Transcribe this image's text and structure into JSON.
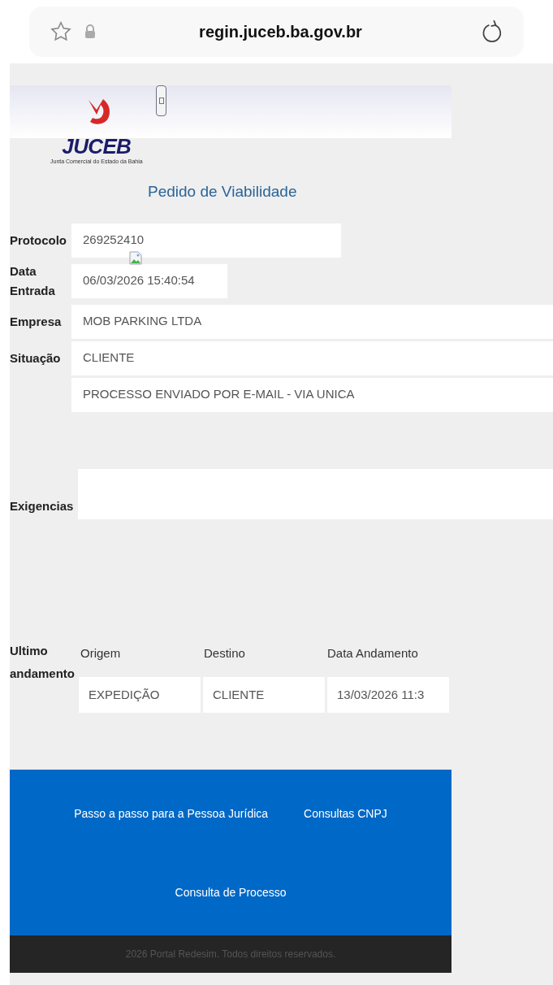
{
  "browser": {
    "url": "regin.juceb.ba.gov.br"
  },
  "logo": {
    "text": "JUCEB",
    "subtitle": "Junta Comercial do Estado da Bahia"
  },
  "title": "Pedido de Viabilidade",
  "fields": [
    {
      "label": "Protocolo",
      "values": [
        "269252410"
      ]
    },
    {
      "label": "Data Entrada",
      "values": [
        "06/03/2026 15:40:54"
      ]
    },
    {
      "label": "Empresa",
      "values": [
        "MOB PARKING LTDA"
      ]
    },
    {
      "label": "Situação",
      "values": [
        "CLIENTE",
        "PROCESSO ENVIADO POR E-MAIL - VIA UNICA"
      ]
    }
  ],
  "exigencias": {
    "label": "Exigencias"
  },
  "andamento": {
    "label": "Ultimo andamento",
    "columns": [
      "Origem",
      "Destino",
      "Data Andamento"
    ],
    "row": [
      "EXPEDIÇÃO",
      "CLIENTE",
      "13/03/2026 11:3"
    ]
  },
  "footer": {
    "links": [
      "Passo a passo para a Pessoa Jurídica",
      "Consultas CNPJ",
      "Consulta de Processo"
    ],
    "copyright": "2026 Portal Redesim. Todos direitos reservados."
  }
}
